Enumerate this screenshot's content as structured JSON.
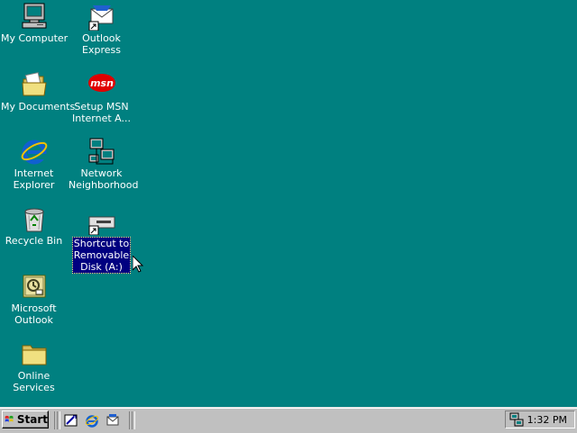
{
  "desktop": {
    "background_color": "#008080",
    "icons": [
      {
        "lines": [
          "My Computer"
        ],
        "icon": "my-computer-icon"
      },
      {
        "lines": [
          "My Documents"
        ],
        "icon": "folder-documents-icon"
      },
      {
        "lines": [
          "Internet",
          "Explorer"
        ],
        "icon": "internet-explorer-icon"
      },
      {
        "lines": [
          "Recycle Bin"
        ],
        "icon": "recycle-bin-icon"
      },
      {
        "lines": [
          "Microsoft",
          "Outlook"
        ],
        "icon": "outlook-icon"
      },
      {
        "lines": [
          "Online",
          "Services"
        ],
        "icon": "folder-icon"
      },
      {
        "lines": [
          "Outlook",
          "Express"
        ],
        "icon": "outlook-express-icon"
      },
      {
        "lines": [
          "Setup MSN",
          "Internet A..."
        ],
        "icon": "msn-icon"
      },
      {
        "lines": [
          "Network",
          "Neighborhood"
        ],
        "icon": "network-neighborhood-icon"
      },
      {
        "lines": [
          "Shortcut to",
          "Removable",
          "Disk (A:)"
        ],
        "icon": "removable-disk-shortcut-icon",
        "selected": true
      }
    ]
  },
  "taskbar": {
    "start_label": "Start",
    "quick_launch": [
      "show-desktop-icon",
      "internet-explorer-icon",
      "outlook-express-icon"
    ],
    "clock": "1:32 PM",
    "tray_icon": "network-tray-icon"
  }
}
